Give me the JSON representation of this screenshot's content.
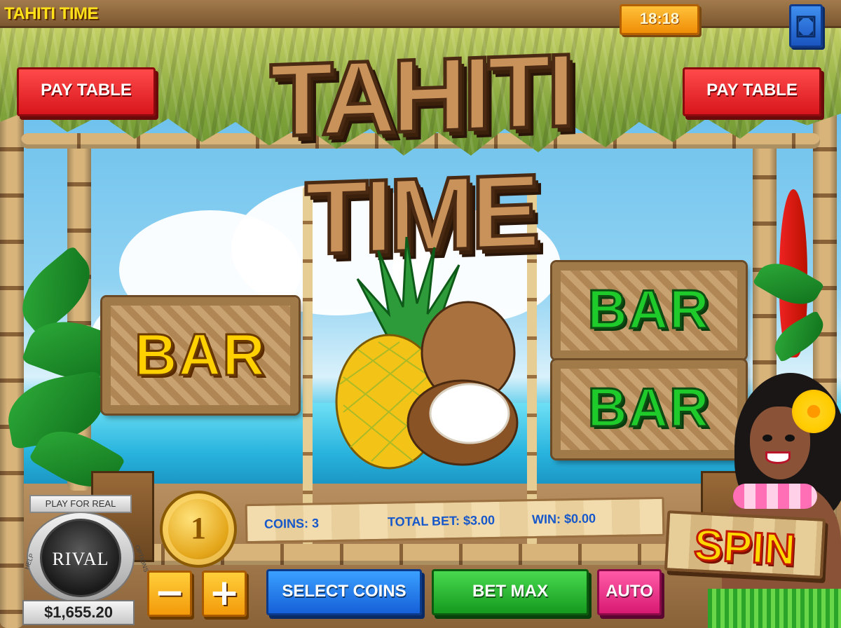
{
  "header": {
    "game_name": "TAHITI TIME",
    "clock": "18:18"
  },
  "logo": {
    "text": "TAHITI TIME"
  },
  "buttons": {
    "pay_table_left": "PAY TABLE",
    "pay_table_right": "PAY TABLE",
    "minus": "−",
    "plus": "+",
    "select_coins": "SELECT COINS",
    "bet_max": "BET MAX",
    "auto": "AUTO",
    "spin": "SPIN"
  },
  "reels": {
    "reel1": {
      "symbol": "BAR"
    },
    "reel2": {
      "symbol": "pineapple-coconut"
    },
    "reel3": {
      "symbol_top": "BAR",
      "symbol_bottom": "BAR"
    }
  },
  "info": {
    "coins": "COINS: 3",
    "total_bet": "TOTAL BET: $3.00",
    "win": "WIN: $0.00"
  },
  "coin_value": "1",
  "badge": {
    "play_for_real": "PLAY FOR REAL",
    "brand": "RIVAL",
    "help": "HELP",
    "options": "OPTIONS",
    "balance": "$1,655.20"
  },
  "colors": {
    "pay_table": "#d7161c",
    "select_coins": "#1660d8",
    "bet_max": "#159a1f",
    "auto": "#d81a72",
    "info_text": "#1657c9"
  }
}
